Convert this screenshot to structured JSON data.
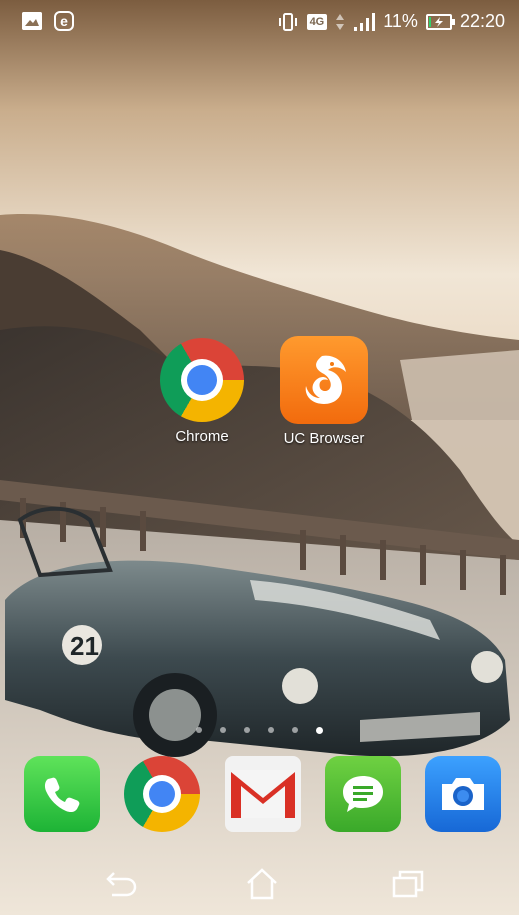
{
  "status_bar": {
    "left_icons": [
      "image-icon",
      "e-icon"
    ],
    "network_label": "4G",
    "battery_percent": "11%",
    "time": "22:20",
    "battery_level": 0.11
  },
  "home": {
    "apps": [
      {
        "label": "Chrome",
        "icon": "chrome-icon"
      },
      {
        "label": "UC Browser",
        "icon": "uc-browser-icon"
      }
    ]
  },
  "page_indicator": {
    "count": 6,
    "active_index": 5
  },
  "dock": {
    "apps": [
      {
        "icon": "phone-icon",
        "color": "#2bc13f"
      },
      {
        "icon": "chrome-icon",
        "color": "#4285f4"
      },
      {
        "icon": "gmail-icon",
        "color": "#d93025"
      },
      {
        "icon": "messages-icon",
        "color": "#4cb62e"
      },
      {
        "icon": "camera-icon",
        "color": "#2a84ef"
      }
    ]
  },
  "nav": {
    "buttons": [
      "back-icon",
      "home-icon",
      "recents-icon"
    ]
  }
}
